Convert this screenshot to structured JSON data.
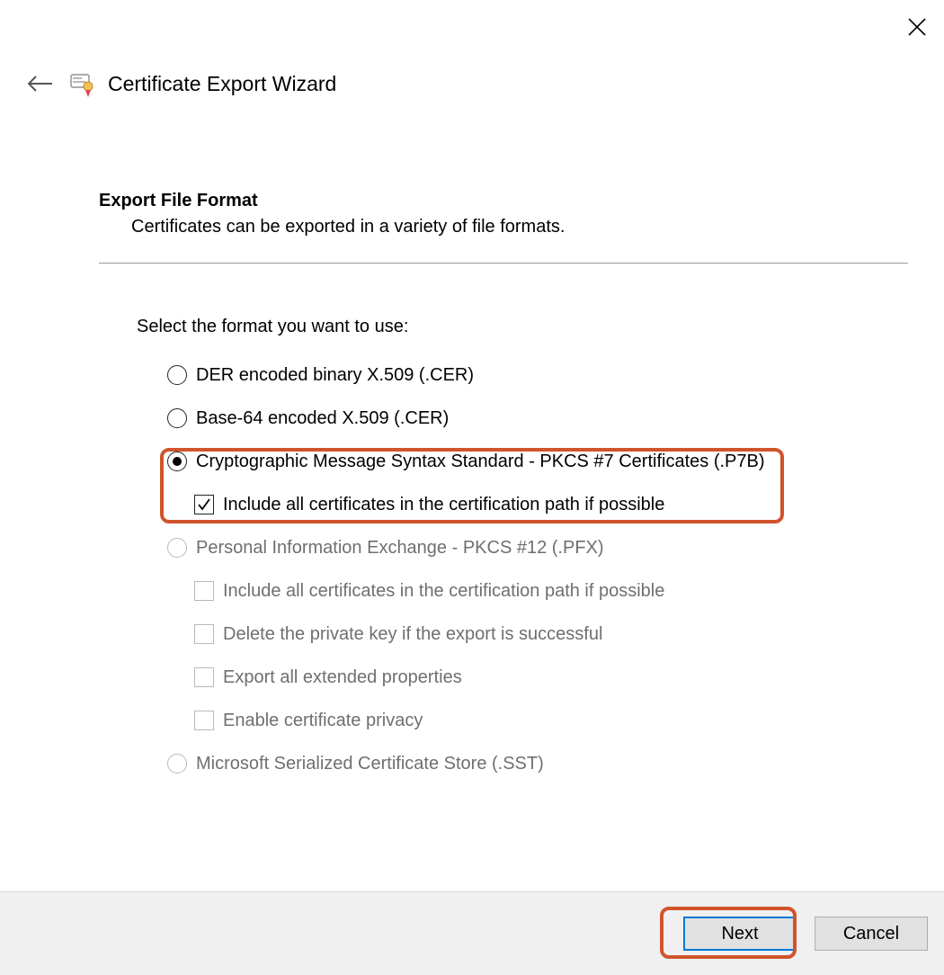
{
  "window": {
    "title": "Certificate Export Wizard"
  },
  "section": {
    "title": "Export File Format",
    "subtitle": "Certificates can be exported in a variety of file formats."
  },
  "prompt": "Select the format you want to use:",
  "options": {
    "der": {
      "label": "DER encoded binary X.509 (.CER)"
    },
    "b64": {
      "label": "Base-64 encoded X.509 (.CER)"
    },
    "p7b": {
      "label": "Cryptographic Message Syntax Standard - PKCS #7 Certificates (.P7B)"
    },
    "p7b_include": {
      "label": "Include all certificates in the certification path if possible"
    },
    "pfx": {
      "label": "Personal Information Exchange - PKCS #12 (.PFX)"
    },
    "pfx_include": {
      "label": "Include all certificates in the certification path if possible"
    },
    "pfx_delete": {
      "label": "Delete the private key if the export is successful"
    },
    "pfx_ext": {
      "label": "Export all extended properties"
    },
    "pfx_privacy": {
      "label": "Enable certificate privacy"
    },
    "sst": {
      "label": "Microsoft Serialized Certificate Store (.SST)"
    }
  },
  "footer": {
    "next": "Next",
    "cancel": "Cancel"
  }
}
